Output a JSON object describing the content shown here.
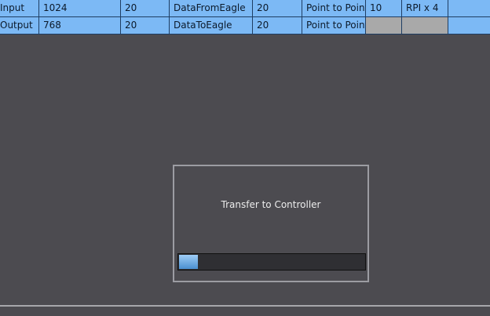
{
  "connection_table": {
    "rows": [
      {
        "cells": [
          "Input",
          "1024",
          "20",
          "DataFromEagle",
          "20",
          "Point to Point c",
          "10",
          "RPI x 4",
          ""
        ],
        "disabled_cells": []
      },
      {
        "cells": [
          "Output",
          "768",
          "20",
          "DataToEagle",
          "20",
          "Point to Point c",
          "",
          "",
          ""
        ],
        "disabled_cells": [
          6,
          7
        ]
      }
    ]
  },
  "transfer_dialog": {
    "title": "Transfer to Controller",
    "progress_percent": 10
  },
  "colors": {
    "selected_row": "#7cb9f5",
    "background": "#4c4b50",
    "disabled_cell": "#a9a9a9"
  }
}
